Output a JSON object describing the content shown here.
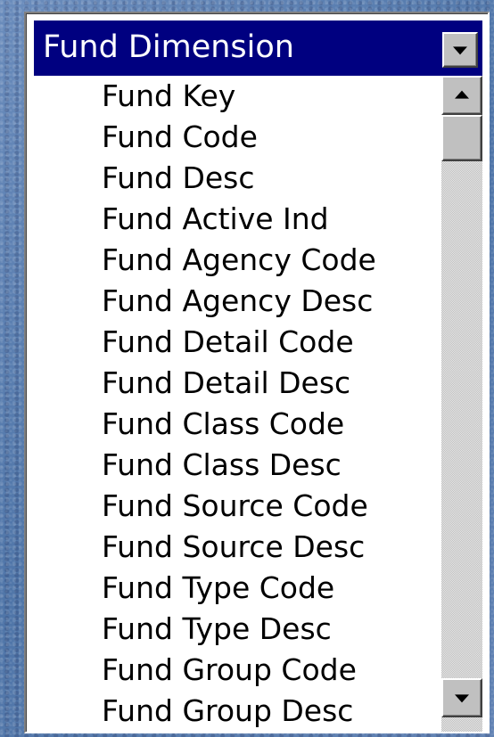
{
  "dimension": {
    "title": "Fund Dimension",
    "dropdown_icon": "chevron-down-icon",
    "items": [
      "Fund Key",
      "Fund Code",
      "Fund Desc",
      "Fund Active Ind",
      "Fund Agency Code",
      "Fund Agency Desc",
      "Fund Detail Code",
      "Fund Detail Desc",
      "Fund Class Code",
      "Fund Class Desc",
      "Fund Source Code",
      "Fund Source Desc",
      "Fund Type Code",
      "Fund Type Desc",
      "Fund Group Code",
      "Fund Group Desc"
    ]
  },
  "scrollbar": {
    "up_icon": "arrow-up-icon",
    "down_icon": "arrow-down-icon",
    "position": 0
  },
  "colors": {
    "titlebar": "#000080",
    "title_text": "#ffffff",
    "list_background": "#ffffff",
    "scroll_button": "#c0c0c0",
    "slide_background": "#5a7fb0"
  }
}
